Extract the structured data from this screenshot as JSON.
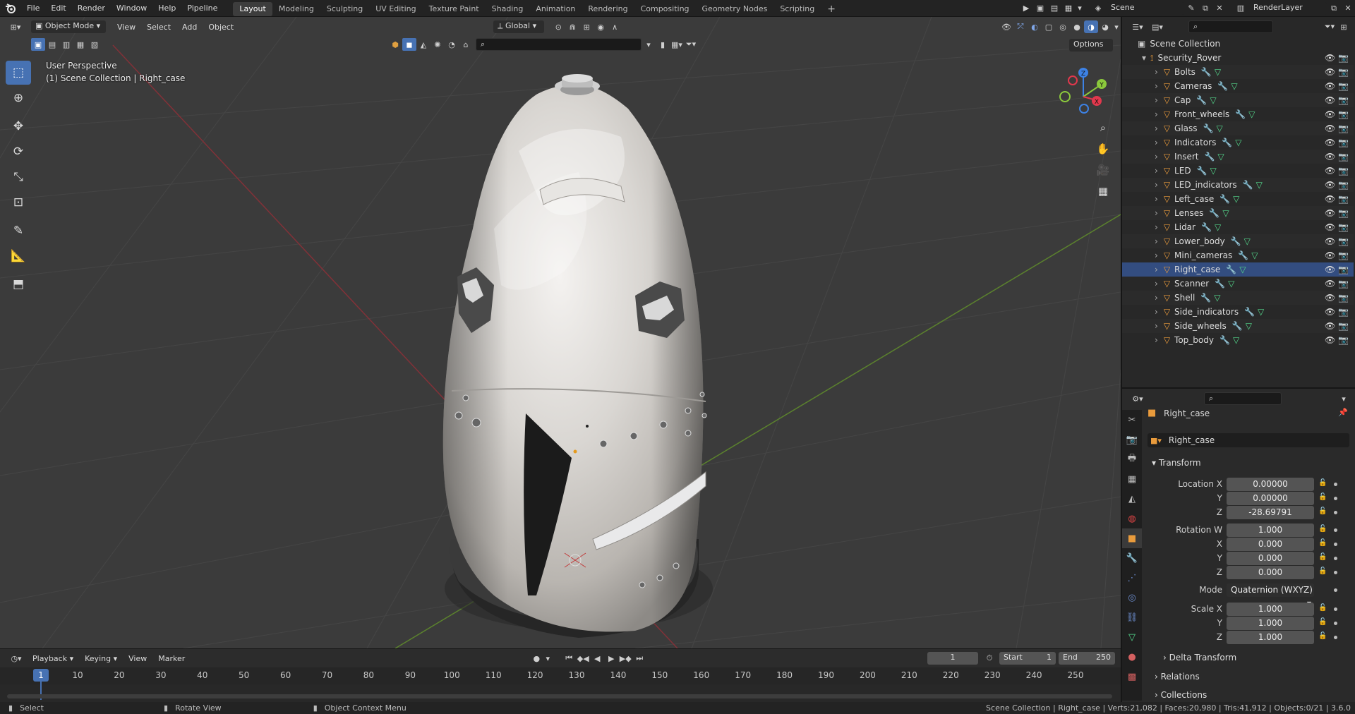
{
  "topbar": {
    "menus": [
      "File",
      "Edit",
      "Render",
      "Window",
      "Help",
      "Pipeline"
    ],
    "workspaces": [
      "Layout",
      "Modeling",
      "Sculpting",
      "UV Editing",
      "Texture Paint",
      "Shading",
      "Animation",
      "Rendering",
      "Compositing",
      "Geometry Nodes",
      "Scripting"
    ],
    "active_workspace": "Layout",
    "add_tab": "+",
    "scene_field": "Scene",
    "renderlayer_field": "RenderLayer"
  },
  "viewport": {
    "mode": "Object Mode",
    "menus": [
      "View",
      "Select",
      "Add",
      "Object"
    ],
    "orientation": "Global",
    "options_label": "Options",
    "overlay_line1": "User Perspective",
    "overlay_line2": "(1) Scene Collection | Right_case",
    "gizmo_axes": {
      "z": "Z",
      "y": "Y",
      "x": "X"
    }
  },
  "outliner": {
    "root": "Scene Collection",
    "collection": "Security_Rover",
    "objects": [
      "Bolts",
      "Cameras",
      "Cap",
      "Front_wheels",
      "Glass",
      "Indicators",
      "Insert",
      "LED",
      "LED_indicators",
      "Left_case",
      "Lenses",
      "Lidar",
      "Lower_body",
      "Mini_cameras",
      "Right_case",
      "Scanner",
      "Shell",
      "Side_indicators",
      "Side_wheels",
      "Top_body"
    ],
    "selected": "Right_case"
  },
  "properties": {
    "object_name": "Right_case",
    "datablock_name": "Right_case",
    "transform_label": "Transform",
    "location": {
      "label_x": "Location X",
      "label_y": "Y",
      "label_z": "Z",
      "x": "0.00000",
      "y": "0.00000",
      "z": "-28.69791"
    },
    "rotation": {
      "label_w": "Rotation W",
      "label_x": "X",
      "label_y": "Y",
      "label_z": "Z",
      "w": "1.000",
      "x": "0.000",
      "y": "0.000",
      "z": "0.000"
    },
    "mode_label": "Mode",
    "mode_value": "Quaternion (WXYZ)",
    "scale": {
      "label_x": "Scale X",
      "label_y": "Y",
      "label_z": "Z",
      "x": "1.000",
      "y": "1.000",
      "z": "1.000"
    },
    "delta_transform": "Delta Transform",
    "relations": "Relations",
    "collections": "Collections"
  },
  "timeline": {
    "menus": [
      "Playback",
      "Keying",
      "View",
      "Marker"
    ],
    "current_frame": "1",
    "start_label": "Start",
    "start_value": "1",
    "end_label": "End",
    "end_value": "250",
    "ticks": [
      "10",
      "20",
      "30",
      "40",
      "50",
      "60",
      "70",
      "80",
      "90",
      "100",
      "110",
      "120",
      "130",
      "140",
      "150",
      "160",
      "170",
      "180",
      "190",
      "200",
      "210",
      "220",
      "230",
      "240",
      "250"
    ],
    "playhead_label": "1"
  },
  "statusbar": {
    "select": "Select",
    "rotate": "Rotate View",
    "context": "Object Context Menu",
    "stats": "Scene Collection | Right_case | Verts:21,082 | Faces:20,980 | Tris:41,912 | Objects:0/21 | 3.6.0"
  },
  "colors": {
    "accent": "#4772b3",
    "object_orange": "#e99b3c",
    "modifier_blue": "#6d8ecf",
    "mesh_green": "#54d98c",
    "axis_x_red": "#e2384d",
    "axis_y_green": "#8bc93c",
    "axis_z_blue": "#3d82e5"
  }
}
